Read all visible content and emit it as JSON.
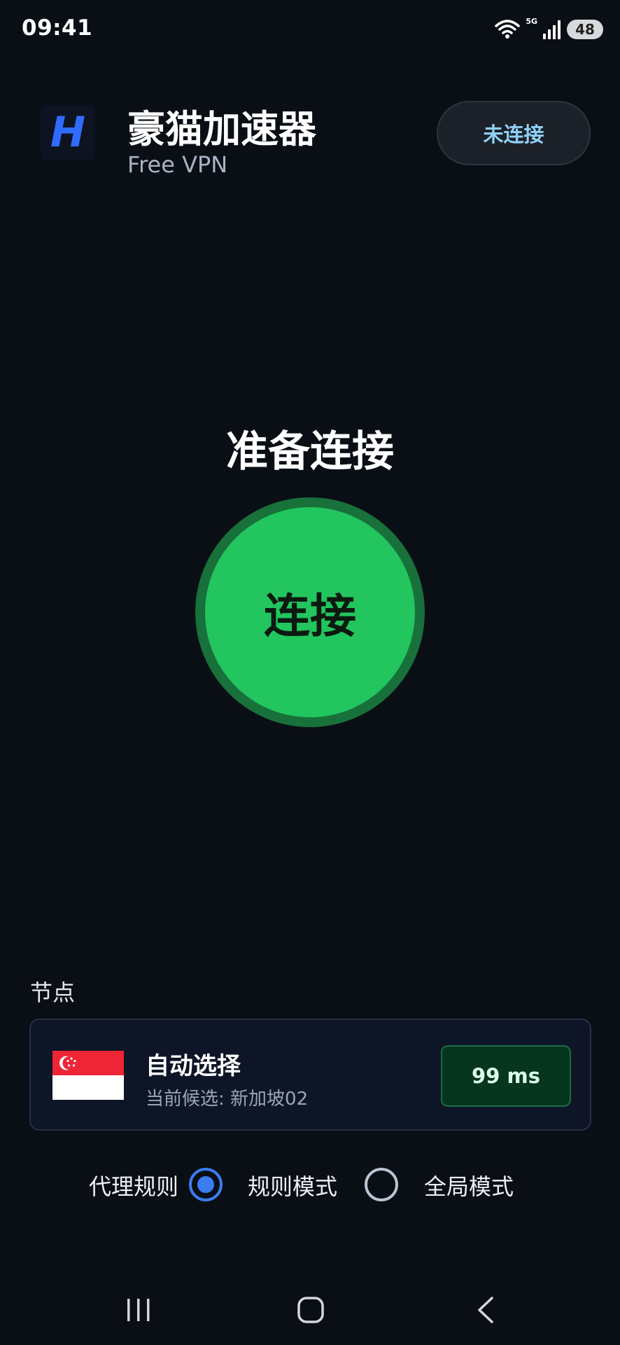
{
  "status_bar": {
    "time": "09:41",
    "network_label": "5G",
    "battery": "48"
  },
  "header": {
    "title": "豪猫加速器",
    "subtitle": "Free VPN",
    "connection_status": "未连接",
    "logo_letter": "H"
  },
  "main": {
    "ready_text": "准备连接",
    "connect_label": "连接"
  },
  "node": {
    "section_label": "节点",
    "name": "自动选择",
    "current": "当前候选: 新加坡02",
    "latency": "99 ms",
    "flag": "singapore-flag"
  },
  "proxy": {
    "label": "代理规则",
    "options": [
      {
        "label": "规则模式",
        "selected": true
      },
      {
        "label": "全局模式",
        "selected": false
      }
    ]
  },
  "colors": {
    "background": "#0a0e15",
    "accent_green": "#22c55e",
    "radio_blue": "#3b7cf0",
    "status_text": "#8fd0f5"
  }
}
